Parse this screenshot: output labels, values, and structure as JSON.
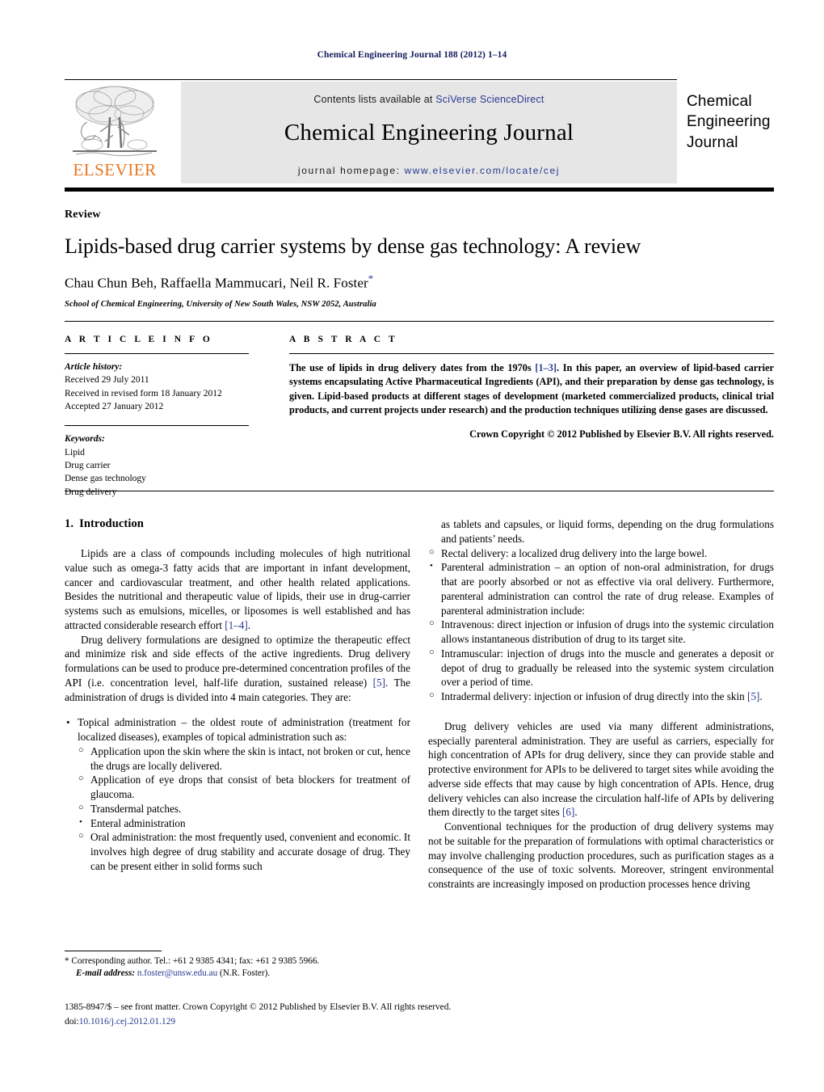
{
  "running_head": "Chemical Engineering Journal 188 (2012) 1–14",
  "masthead": {
    "contents_prefix": "Contents lists available at ",
    "contents_link": "SciVerse ScienceDirect",
    "journal_title": "Chemical Engineering Journal",
    "homepage_prefix": "journal homepage: ",
    "homepage_url": "www.elsevier.com/locate/cej",
    "publisher_wordmark": "ELSEVIER",
    "journal_logo_lines": [
      "Chemical",
      "Engineering",
      "Journal"
    ],
    "link_color": "#2a3990",
    "elsevier_orange": "#e87722",
    "panel_bg": "#e6e6e6"
  },
  "title_block": {
    "article_kind": "Review",
    "title": "Lipids-based drug carrier systems by dense gas technology: A review",
    "authors": "Chau Chun Beh, Raffaella Mammucari, Neil R. Foster",
    "corresponding_marker": "*",
    "affiliation": "School of Chemical Engineering, University of New South Wales, NSW 2052, Australia"
  },
  "article_info": {
    "heading": "A R T I C L E    I N F O",
    "history_label": "Article history:",
    "history": [
      "Received 29 July 2011",
      "Received in revised form 18 January 2012",
      "Accepted 27 January 2012"
    ],
    "keywords_label": "Keywords:",
    "keywords": [
      "Lipid",
      "Drug carrier",
      "Dense gas technology",
      "Drug delivery"
    ]
  },
  "abstract": {
    "heading": "A B S T R A C T",
    "part1": "The use of lipids in drug delivery dates from the 1970s ",
    "ref1": "[1–3]",
    "part2": ". In this paper, an overview of lipid-based carrier systems encapsulating Active Pharmaceutical Ingredients (API), and their preparation by dense gas technology, is given. Lipid-based products at different stages of development (marketed commercialized products, clinical trial products, and current projects under research) and the production techniques utilizing dense gases are discussed.",
    "copyright": "Crown Copyright © 2012 Published by Elsevier B.V. All rights reserved."
  },
  "body": {
    "section_number": "1.",
    "section_title": "Introduction",
    "left_paragraph_1_a": "Lipids are a class of compounds including molecules of high nutritional value such as omega-3 fatty acids that are important in infant development, cancer and cardiovascular treatment, and other health related applications. Besides the nutritional and therapeutic value of lipids, their use in drug-carrier systems such as emulsions, micelles, or liposomes is well established and has attracted considerable research effort ",
    "left_paragraph_1_ref": "[1–4]",
    "left_paragraph_1_b": ".",
    "left_paragraph_2_a": "Drug delivery formulations are designed to optimize the therapeutic effect and minimize risk and side effects of the active ingredients. Drug delivery formulations can be used to produce pre-determined concentration profiles of the API (i.e. concentration level, half-life duration, sustained release) ",
    "left_paragraph_2_ref": "[5]",
    "left_paragraph_2_b": ". The administration of drugs is divided into 4 main categories. They are:",
    "bullet_topical": "Topical administration – the oldest route of administration (treatment for localized diseases), examples of topical administration such as:",
    "sub_topical_1": "Application upon the skin where the skin is intact, not broken or cut, hence the drugs are locally delivered.",
    "sub_topical_2": "Application of eye drops that consist of beta blockers for treatment of glaucoma.",
    "sub_topical_3": "Transdermal patches.",
    "bullet_enteral": "Enteral administration",
    "sub_enteral_oral": "Oral administration: the most frequently used, convenient and economic. It involves high degree of drug stability and accurate dosage of drug. They can be present either in solid forms such",
    "right_oral_continued": "as tablets and capsules, or liquid forms, depending on the drug formulations and patients’ needs.",
    "sub_rectal": "Rectal delivery: a localized drug delivery into the large bowel.",
    "bullet_parenteral": "Parenteral administration – an option of non-oral administration, for drugs that are poorly absorbed or not as effective via oral delivery. Furthermore, parenteral administration can control the rate of drug release. Examples of parenteral administration include:",
    "sub_intravenous": "Intravenous: direct injection or infusion of drugs into the systemic circulation allows instantaneous distribution of drug to its target site.",
    "sub_intramuscular": "Intramuscular: injection of drugs into the muscle and generates a deposit or depot of drug to gradually be released into the systemic system circulation over a period of time.",
    "sub_intradermal_a": "Intradermal delivery: injection or infusion of drug directly into the skin ",
    "sub_intradermal_ref": "[5]",
    "sub_intradermal_b": ".",
    "right_paragraph_1_a": "Drug delivery vehicles are used via many different administrations, especially parenteral administration. They are useful as carriers, especially for high concentration of APIs for drug delivery, since they can provide stable and protective environment for APIs to be delivered to target sites while avoiding the adverse side effects that may cause by high concentration of APIs. Hence, drug delivery vehicles can also increase the circulation half-life of APIs by delivering them directly to the target sites ",
    "right_paragraph_1_ref": "[6]",
    "right_paragraph_1_b": ".",
    "right_paragraph_2": "Conventional techniques for the production of drug delivery systems may not be suitable for the preparation of formulations with optimal characteristics or may involve challenging production procedures, such as purification stages as a consequence of the use of toxic solvents. Moreover, stringent environmental constraints are increasingly imposed on production processes hence driving"
  },
  "footnote": {
    "marker": "*",
    "line1": "Corresponding author. Tel.: +61 2 9385 4341; fax: +61 2 9385 5966.",
    "email_label": "E-mail address:",
    "email": "n.foster@unsw.edu.au",
    "email_suffix": " (N.R. Foster)."
  },
  "page_footer": {
    "line1": "1385-8947/$ – see front matter. Crown Copyright © 2012 Published by Elsevier B.V. All rights reserved.",
    "doi_label": "doi:",
    "doi_value": "10.1016/j.cej.2012.01.129"
  }
}
